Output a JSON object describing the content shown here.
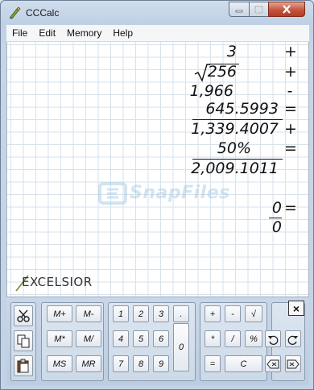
{
  "window": {
    "title": "CCCalc"
  },
  "menu": [
    "File",
    "Edit",
    "Memory",
    "Help"
  ],
  "tape": [
    {
      "value": "3",
      "op": "+"
    },
    {
      "value": "256",
      "op": "+",
      "sqrt": true
    },
    {
      "value": "1,966",
      "op": "-"
    },
    {
      "value": "645.5993",
      "op": "="
    },
    {
      "value": "1,339.4007",
      "op": "+"
    },
    {
      "value": "50%",
      "op": "="
    },
    {
      "value": "2,009.1011",
      "op": ""
    }
  ],
  "fraction": {
    "numerator": "0",
    "denominator": "0",
    "op": "="
  },
  "watermark": "SnapFiles",
  "logo": "EXCELSIOR",
  "keypad": {
    "memory": [
      "M+",
      "M-",
      "M*",
      "M/",
      "MS",
      "MR"
    ],
    "digits": [
      "1",
      "2",
      "3",
      "4",
      "5",
      "6",
      "7",
      "8",
      "9",
      "0",
      "."
    ],
    "ops": [
      "+",
      "-",
      "√",
      "*",
      "/",
      "%",
      "=",
      "C"
    ],
    "close": "×"
  },
  "colors": {
    "grid": "#d7e2ec",
    "paper": "#ffffff",
    "frame": "#c3d2e5"
  }
}
